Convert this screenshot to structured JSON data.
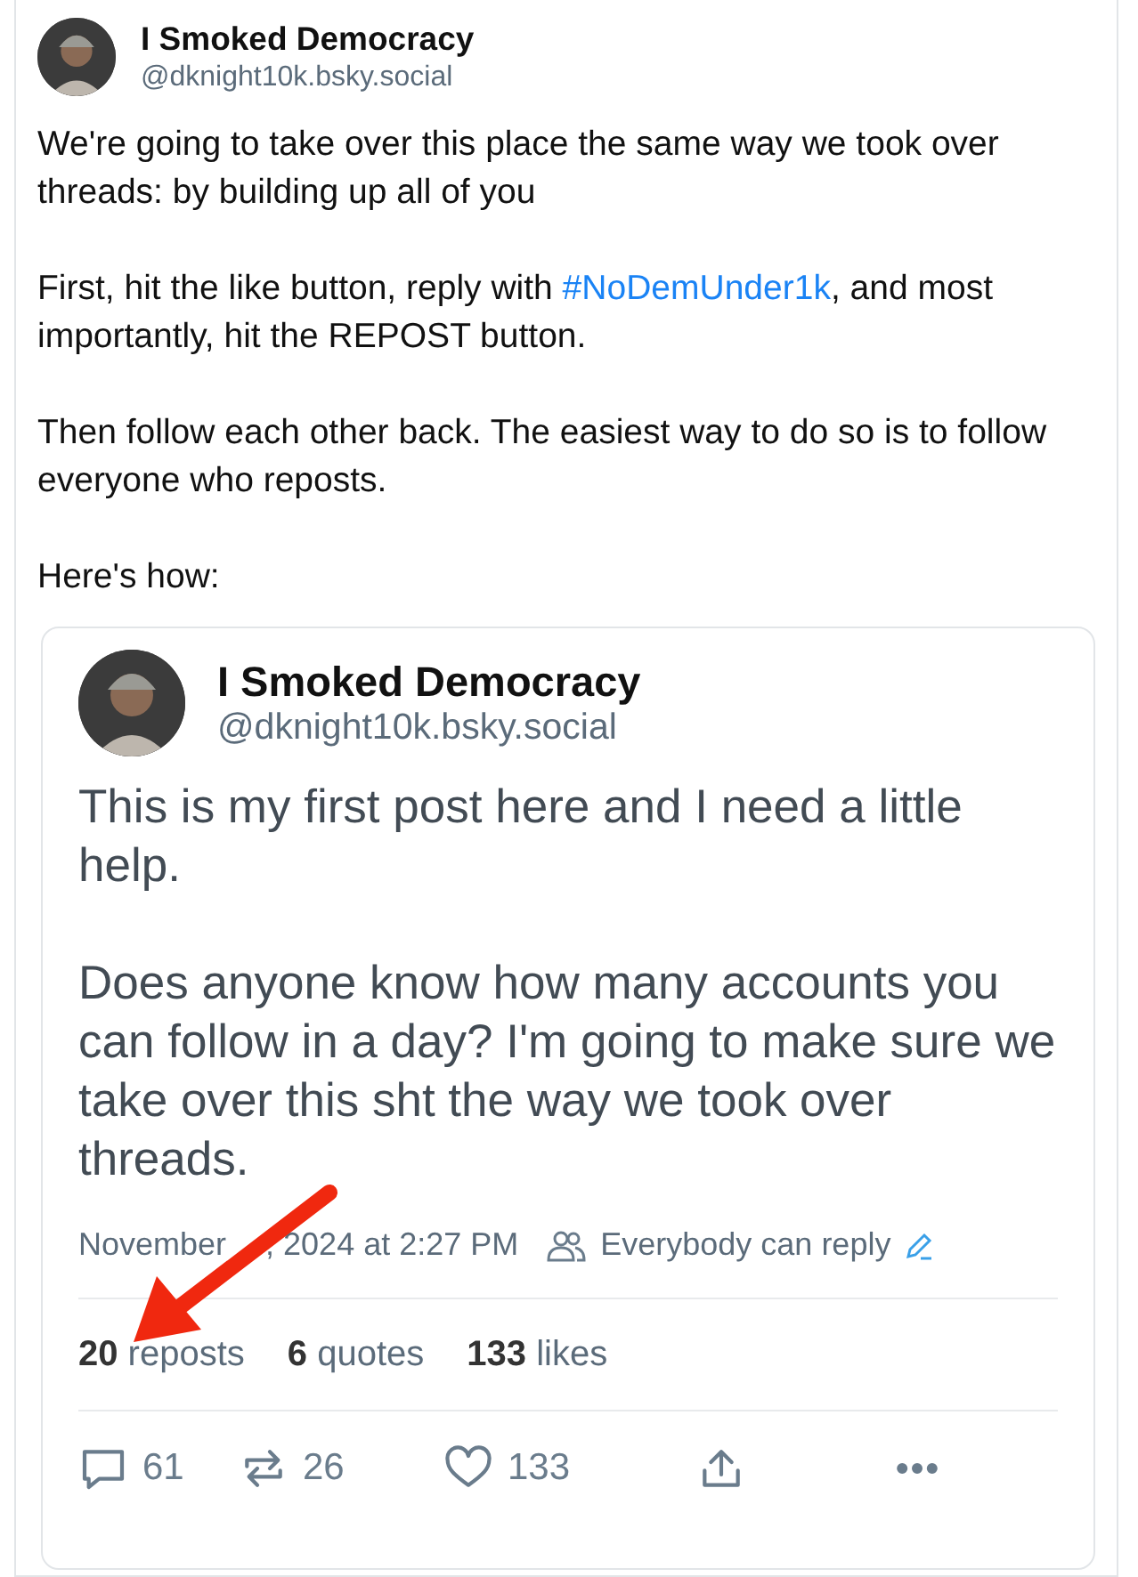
{
  "post": {
    "author": {
      "name": "I Smoked Democracy",
      "handle": "@dknight10k.bsky.social"
    },
    "paragraphs": [
      "We're going to take over this place the same way we took over threads: by building up all of you",
      [
        {
          "text": "First, hit the like button, reply with "
        },
        {
          "text": "#NoDemUnder1k",
          "kind": "hashtag"
        },
        {
          "text": ", and most importantly, hit the REPOST button."
        }
      ],
      "Then follow each other back. The easiest way to do so is to follow everyone who reposts.",
      "Here's how:"
    ]
  },
  "quoted": {
    "author": {
      "name": "I Smoked Democracy",
      "handle": "@dknight10k.bsky.social"
    },
    "paragraphs": [
      "This is my first post here and I need a little help.",
      "Does anyone know how many accounts you can follow in a day? I'm going to make sure we take over this sht the way we took over threads."
    ],
    "date_visible_start": "November",
    "date_visible_end": ", 2024 at 2:27 PM",
    "reply_setting": "Everybody can reply",
    "stats": [
      {
        "count": "20",
        "label": "reposts"
      },
      {
        "count": "6",
        "label": "quotes"
      },
      {
        "count": "133",
        "label": "likes"
      }
    ],
    "actions": [
      {
        "kind": "reply",
        "count": "61"
      },
      {
        "kind": "repost",
        "count": "26"
      },
      {
        "kind": "like",
        "count": "133"
      },
      {
        "kind": "share"
      },
      {
        "kind": "more"
      }
    ]
  },
  "annotation": {
    "kind": "arrow"
  }
}
